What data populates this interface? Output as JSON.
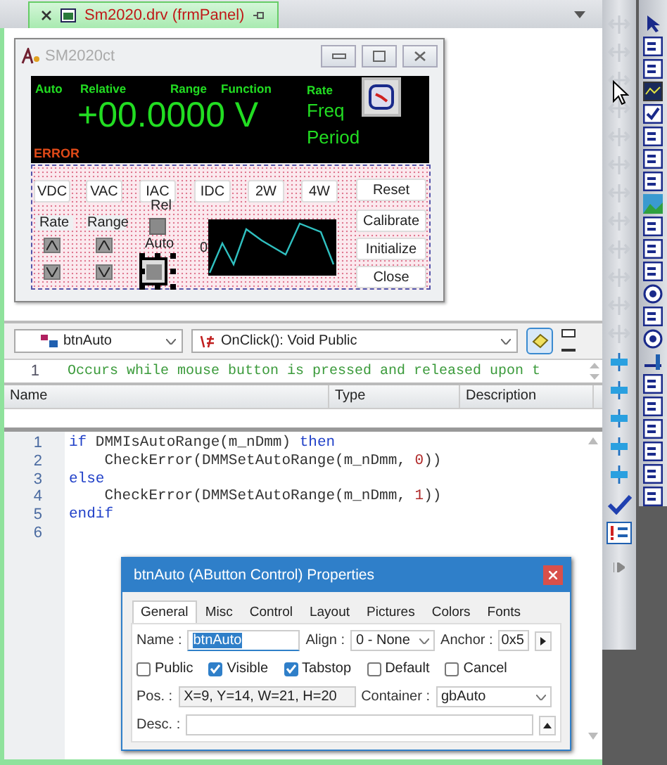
{
  "document_tab": {
    "label": "Sm2020.drv (frmPanel)",
    "selected": true
  },
  "form": {
    "title": "SM2020ct",
    "display": {
      "labels": [
        "Auto",
        "Relative",
        "Range",
        "Function"
      ],
      "rate_label": "Rate",
      "reading": "+00.0000 V",
      "modes": [
        "Freq",
        "Period"
      ],
      "error": "ERROR"
    },
    "function_buttons": [
      "VDC",
      "VAC",
      "IAC",
      "IDC",
      "2W",
      "4W"
    ],
    "action_buttons": [
      "Reset",
      "Calibrate",
      "Initialize",
      "Close"
    ],
    "groups": [
      {
        "label": "Rate"
      },
      {
        "label": "Range"
      }
    ],
    "rel_label": "Rel",
    "auto_label": "Auto",
    "auto_selected": true,
    "chart_axis_label": "0"
  },
  "editor": {
    "object": "btnAuto",
    "event": "OnClick(): Void Public",
    "comment_line": {
      "number": "1",
      "text": "Occurs while mouse button is pressed and released upon t"
    },
    "param_columns": [
      "Name",
      "Type",
      "Description"
    ],
    "code": [
      {
        "number": "1",
        "tokens": [
          {
            "kind": "keyword",
            "text": "if"
          },
          {
            "kind": "plain",
            "text": " DMMIsAutoRange(m_nDmm) "
          },
          {
            "kind": "keyword",
            "text": "then"
          }
        ]
      },
      {
        "number": "2",
        "tokens": [
          {
            "kind": "plain",
            "text": "    CheckError(DMMSetAutoRange(m_nDmm, "
          },
          {
            "kind": "number",
            "text": "0"
          },
          {
            "kind": "plain",
            "text": "))"
          }
        ]
      },
      {
        "number": "3",
        "tokens": [
          {
            "kind": "keyword",
            "text": "else"
          }
        ]
      },
      {
        "number": "4",
        "tokens": [
          {
            "kind": "plain",
            "text": "    CheckError(DMMSetAutoRange(m_nDmm, "
          },
          {
            "kind": "number",
            "text": "1"
          },
          {
            "kind": "plain",
            "text": "))"
          }
        ]
      },
      {
        "number": "5",
        "tokens": [
          {
            "kind": "keyword",
            "text": "endif"
          }
        ]
      },
      {
        "number": "6"
      }
    ]
  },
  "properties": {
    "title": "btnAuto (AButton Control) Properties",
    "tabs": [
      {
        "label": "General",
        "selected": true
      },
      {
        "label": "Misc",
        "selected": false
      },
      {
        "label": "Control",
        "selected": false
      },
      {
        "label": "Layout",
        "selected": false
      },
      {
        "label": "Pictures",
        "selected": false
      },
      {
        "label": "Colors",
        "selected": false
      },
      {
        "label": "Fonts",
        "selected": false
      }
    ],
    "name_label": "Name :",
    "name_value": "btnAuto",
    "align_label": "Align :",
    "align_value": "0 - None",
    "anchor_label": "Anchor :",
    "anchor_value": "0x5",
    "checkboxes": [
      {
        "label": "Public",
        "checked": false
      },
      {
        "label": "Visible",
        "checked": true
      },
      {
        "label": "Tabstop",
        "checked": true
      },
      {
        "label": "Default",
        "checked": false
      },
      {
        "label": "Cancel",
        "checked": false
      }
    ],
    "pos_label": "Pos. :",
    "pos_value": "X=9, Y=14, W=21, H=20",
    "container_label": "Container :",
    "container_value": "gbAuto",
    "desc_label": "Desc. :"
  }
}
